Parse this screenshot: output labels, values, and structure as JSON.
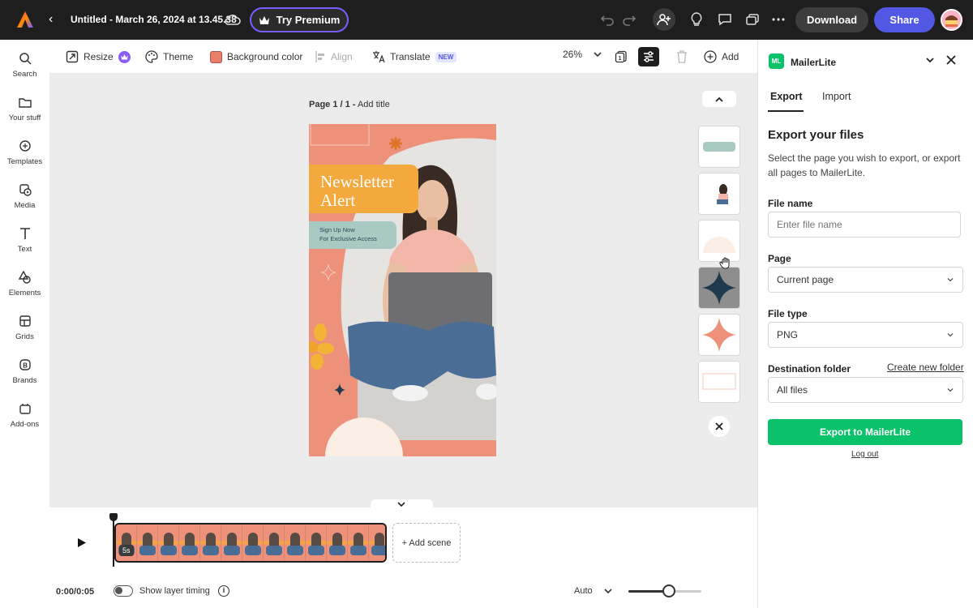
{
  "header": {
    "doc_title": "Untitled - March 26, 2024 at 13.45.38",
    "try_premium": "Try Premium",
    "download": "Download",
    "share": "Share"
  },
  "rail": [
    {
      "label": "Search",
      "icon": "search-icon"
    },
    {
      "label": "Your stuff",
      "icon": "folder-icon"
    },
    {
      "label": "Templates",
      "icon": "templates-icon"
    },
    {
      "label": "Media",
      "icon": "media-icon"
    },
    {
      "label": "Text",
      "icon": "text-icon"
    },
    {
      "label": "Elements",
      "icon": "elements-icon"
    },
    {
      "label": "Grids",
      "icon": "grids-icon"
    },
    {
      "label": "Brands",
      "icon": "brands-icon"
    },
    {
      "label": "Add-ons",
      "icon": "addons-icon"
    }
  ],
  "toolbar": {
    "resize": "Resize",
    "theme": "Theme",
    "background_color": "Background color",
    "background_swatch": "#e97f68",
    "align": "Align",
    "translate": "Translate",
    "new_badge": "NEW",
    "zoom": "26%",
    "add": "Add"
  },
  "canvas": {
    "page_label_prefix": "Page 1 / 1 -",
    "page_label_action": "Add title",
    "design": {
      "headline_line1": "Newsletter",
      "headline_line2": "Alert",
      "cta_line1": "Sign Up Now",
      "cta_line2": "For Exclusive Access",
      "bg_color": "#ed917a",
      "headline_bg": "#f3a93d",
      "cta_bg": "#a9c9c3"
    }
  },
  "timeline": {
    "scene_duration": "5s",
    "add_scene": "+ Add scene",
    "time": "0:00/0:05",
    "show_layer_timing": "Show layer timing",
    "auto": "Auto",
    "zoom_level": 0.55
  },
  "panel": {
    "app_name": "MailerLite",
    "tabs": [
      "Export",
      "Import"
    ],
    "heading": "Export your files",
    "description": "Select the page you wish to export, or export all pages to MailerLite.",
    "file_name_label": "File name",
    "file_name_placeholder": "Enter file name",
    "page_label": "Page",
    "page_value": "Current page",
    "file_type_label": "File type",
    "file_type_value": "PNG",
    "destination_label": "Destination folder",
    "create_folder": "Create new folder",
    "destination_value": "All files",
    "export_button": "Export to MailerLite",
    "logout": "Log out",
    "accent": "#09c269"
  }
}
